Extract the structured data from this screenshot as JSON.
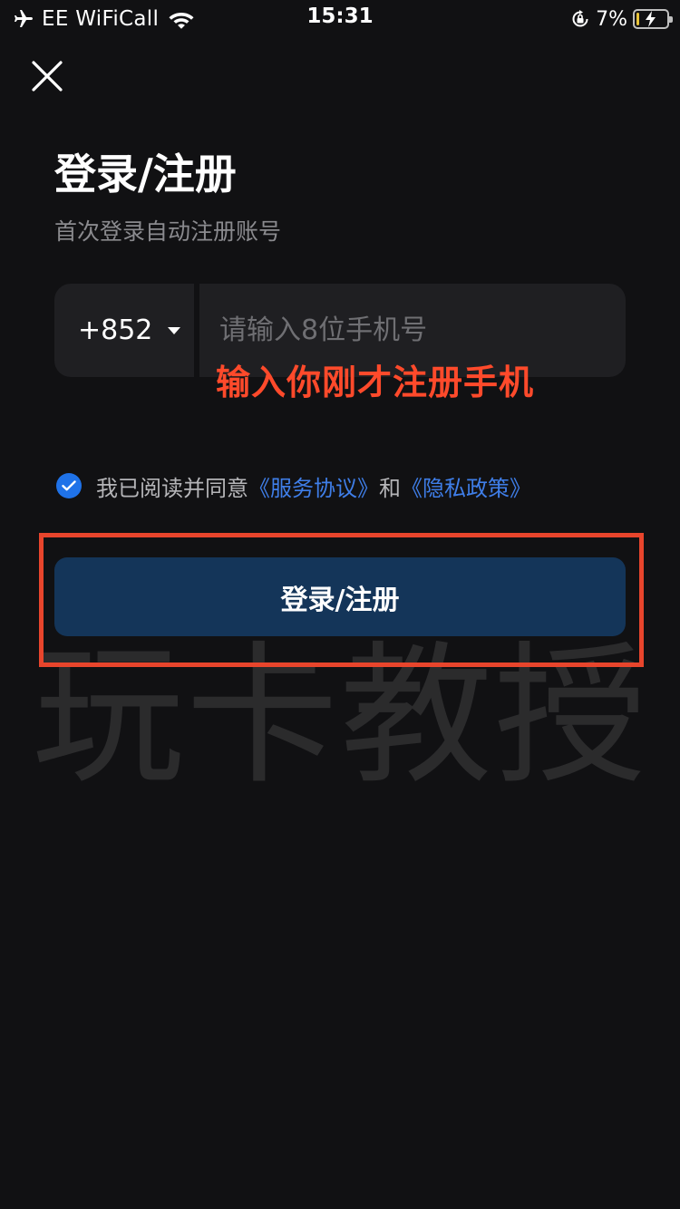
{
  "status_bar": {
    "carrier": "EE WiFiCall",
    "time": "15:31",
    "battery_percent": "7%",
    "battery_level": 0.07,
    "icons": [
      "airplane-icon",
      "wifi-icon",
      "rotation-lock-icon",
      "battery-charging-icon"
    ]
  },
  "header": {
    "close_icon": "close-icon"
  },
  "title": "登录/注册",
  "subtitle": "首次登录自动注册账号",
  "phone": {
    "country_code": "+852",
    "placeholder": "请输入8位手机号",
    "value": ""
  },
  "annotation": "输入你刚才注册手机",
  "agreement": {
    "checked": true,
    "prefix": "我已阅读并同意",
    "terms_link": "《服务协议》",
    "conjunction": "和",
    "privacy_link": "《隐私政策》"
  },
  "login_button": "登录/注册",
  "watermark": "玩卡教授",
  "colors": {
    "background": "#111113",
    "input_bg": "#1f1f22",
    "button_bg": "#143559",
    "link": "#3f7ee8",
    "annotation": "#ff4a2b",
    "highlight_border": "#e8452c"
  }
}
